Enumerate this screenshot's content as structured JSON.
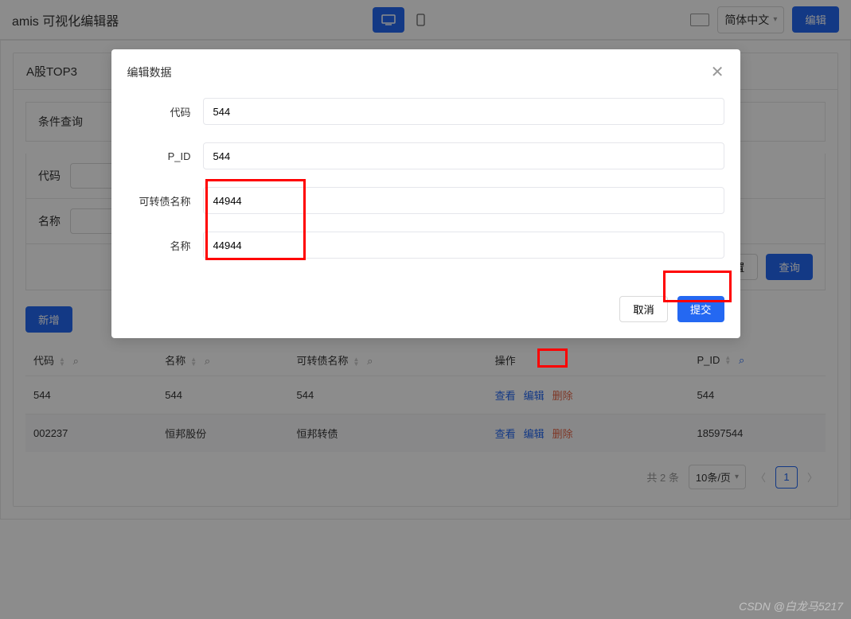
{
  "topbar": {
    "title": "amis 可视化编辑器",
    "lang": "简体中文",
    "edit": "编辑"
  },
  "panel": {
    "title": "A股TOP3",
    "filter_title": "条件查询",
    "label_code": "代码",
    "label_name": "名称",
    "reset": "重置",
    "query": "查询",
    "add": "新增"
  },
  "table": {
    "headers": {
      "code": "代码",
      "name": "名称",
      "bond": "可转债名称",
      "action": "操作",
      "pid": "P_ID"
    },
    "rows": [
      {
        "code": "544",
        "name": "544",
        "bond": "544",
        "pid": "544"
      },
      {
        "code": "002237",
        "name": "恒邦股份",
        "bond": "恒邦转债",
        "pid": "18597544"
      }
    ],
    "actions": {
      "view": "查看",
      "edit": "编辑",
      "delete": "删除"
    }
  },
  "pagination": {
    "total": "共 2 条",
    "page_size": "10条/页",
    "current": "1"
  },
  "dialog": {
    "title": "编辑数据",
    "fields": {
      "code": {
        "label": "代码",
        "value": "544"
      },
      "pid": {
        "label": "P_ID",
        "value": "544"
      },
      "bond": {
        "label": "可转债名称",
        "value": "44944"
      },
      "name": {
        "label": "名称",
        "value": "44944"
      }
    },
    "cancel": "取消",
    "submit": "提交"
  },
  "watermark": "CSDN @白龙马5217"
}
